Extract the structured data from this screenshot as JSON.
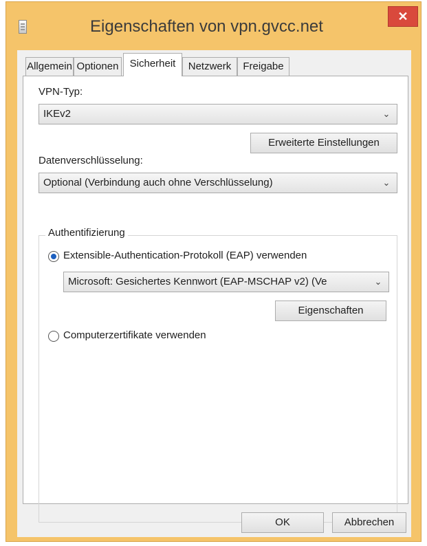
{
  "window": {
    "title": "Eigenschaften von vpn.gvcc.net",
    "close_glyph": "✕"
  },
  "tabs": [
    {
      "label": "Allgemein",
      "active": false
    },
    {
      "label": "Optionen",
      "active": false
    },
    {
      "label": "Sicherheit",
      "active": true
    },
    {
      "label": "Netzwerk",
      "active": false
    },
    {
      "label": "Freigabe",
      "active": false
    }
  ],
  "security": {
    "vpn_type_label": "VPN-Typ:",
    "vpn_type_value": "IKEv2",
    "advanced_button": "Erweiterte Einstellungen",
    "encryption_label": "Datenverschlüsselung:",
    "encryption_value": "Optional (Verbindung auch ohne Verschlüsselung)",
    "auth_group_title": "Authentifizierung",
    "eap_radio_label": "Extensible-Authentication-Protokoll (EAP) verwenden",
    "eap_radio_checked": true,
    "eap_method_value": "Microsoft: Gesichertes Kennwort (EAP-MSCHAP v2) (Ve",
    "eap_properties_button": "Eigenschaften",
    "cert_radio_label": "Computerzertifikate verwenden",
    "cert_radio_checked": false
  },
  "footer": {
    "ok_label": "OK",
    "cancel_label": "Abbrechen"
  },
  "icons": {
    "dropdown": "chevron-down-icon",
    "app": "connection-icon"
  },
  "colors": {
    "titlebar": "#f5c46a",
    "close_button": "#d9493c",
    "radio_selected": "#1c5fbf"
  }
}
